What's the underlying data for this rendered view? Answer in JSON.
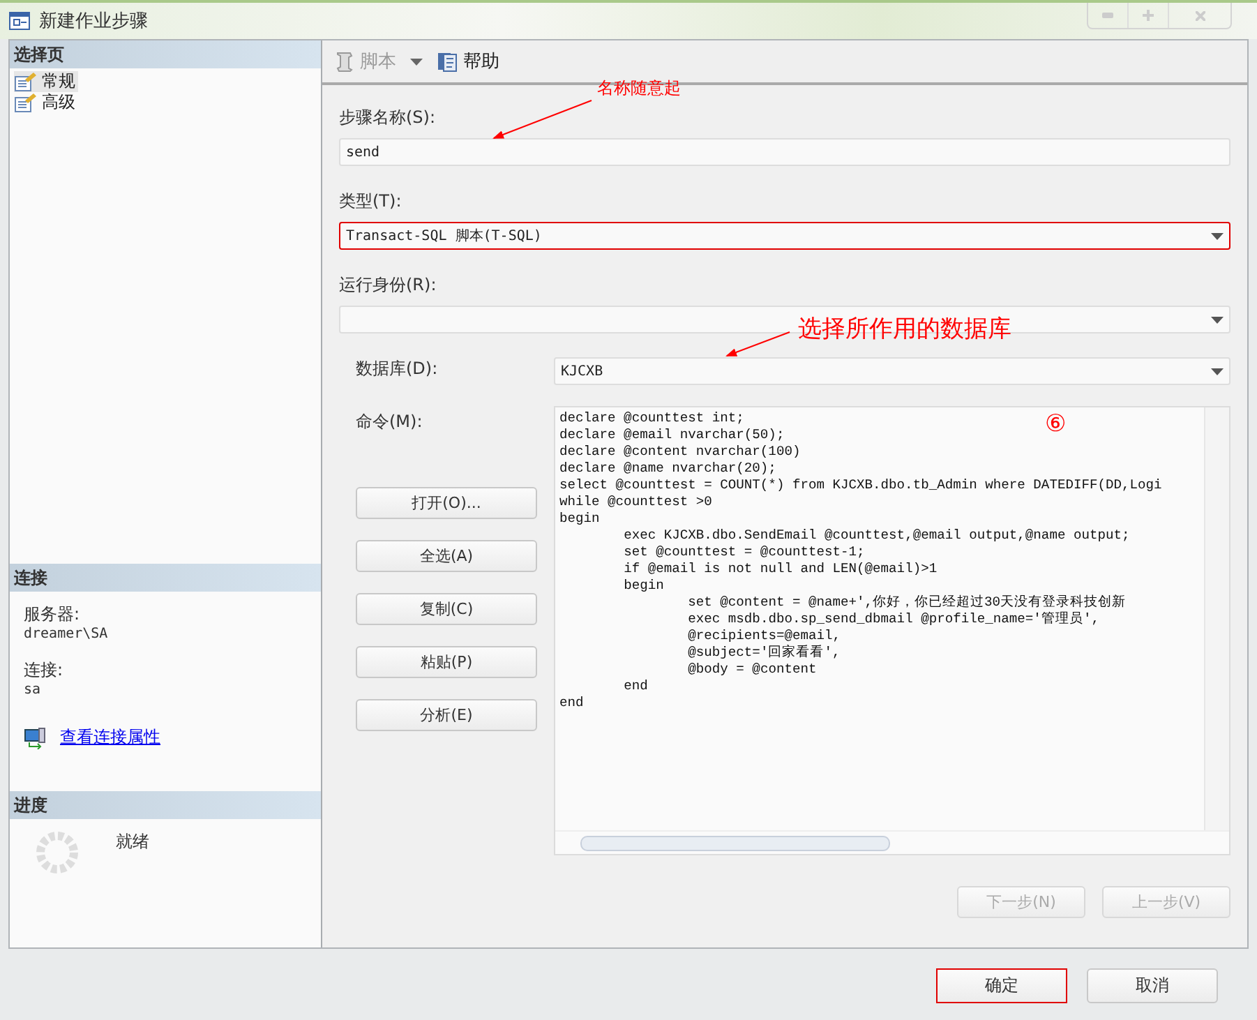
{
  "window": {
    "title": "新建作业步骤"
  },
  "select_page": {
    "header": "选择页",
    "items": [
      {
        "label": "常规",
        "selected": true
      },
      {
        "label": "高级",
        "selected": false
      }
    ]
  },
  "connection": {
    "header": "连接",
    "fields": [
      {
        "label": "服务器:",
        "value": "dreamer\\SA"
      },
      {
        "label": "连接:",
        "value": "sa"
      }
    ],
    "link": "查看连接属性"
  },
  "progress": {
    "header": "进度",
    "status": "就绪"
  },
  "toolbar": [
    {
      "label": "脚本",
      "disabled": true,
      "kind": "script"
    },
    {
      "label": "帮助",
      "disabled": false,
      "kind": "help"
    }
  ],
  "form": {
    "step_name": {
      "label": "步骤名称(S):",
      "value": "send"
    },
    "type": {
      "label": "类型(T):",
      "value": "Transact-SQL 脚本(T-SQL)",
      "highlighted": true
    },
    "run_as": {
      "label": "运行身份(R):"
    },
    "database": {
      "label": "数据库(D):",
      "value": "KJCXB"
    },
    "command": {
      "label": "命令(M):",
      "lines": [
        "declare @counttest int;",
        "declare @email nvarchar(50);",
        "declare @content nvarchar(100)",
        "declare @name nvarchar(20);",
        "select @counttest = COUNT(*) from KJCXB.dbo.tb_Admin where DATEDIFF(DD,Logi",
        "while @counttest >0",
        "begin",
        "\texec KJCXB.dbo.SendEmail @counttest,@email output,@name output;",
        "\tset @counttest = @counttest-1;",
        "\tif @email is not null and LEN(@email)>1",
        "\tbegin",
        "\t\tset @content = @name+',你好，你已经超过30天没有登录科技创新",
        "\t\texec msdb.dbo.sp_send_dbmail @profile_name='管理员',",
        "\t\t@recipients=@email,",
        "\t\t@subject='回家看看',",
        "\t\t@body = @content",
        "\tend",
        "end"
      ]
    },
    "command_buttons": [
      "打开(O)...",
      "全选(A)",
      "复制(C)",
      "粘贴(P)",
      "分析(E)"
    ]
  },
  "nav_buttons": [
    {
      "label": "下一步(N)",
      "disabled": true
    },
    {
      "label": "上一步(V)",
      "disabled": true
    }
  ],
  "dialog_buttons": [
    {
      "label": "确定",
      "highlighted": true
    },
    {
      "label": "取消",
      "highlighted": false
    }
  ],
  "annotations": [
    {
      "text": "名称随意起",
      "kind": "small"
    },
    {
      "text": "选择所作用的数据库",
      "kind": "large"
    },
    {
      "text": "⑥",
      "kind": "circled"
    }
  ]
}
